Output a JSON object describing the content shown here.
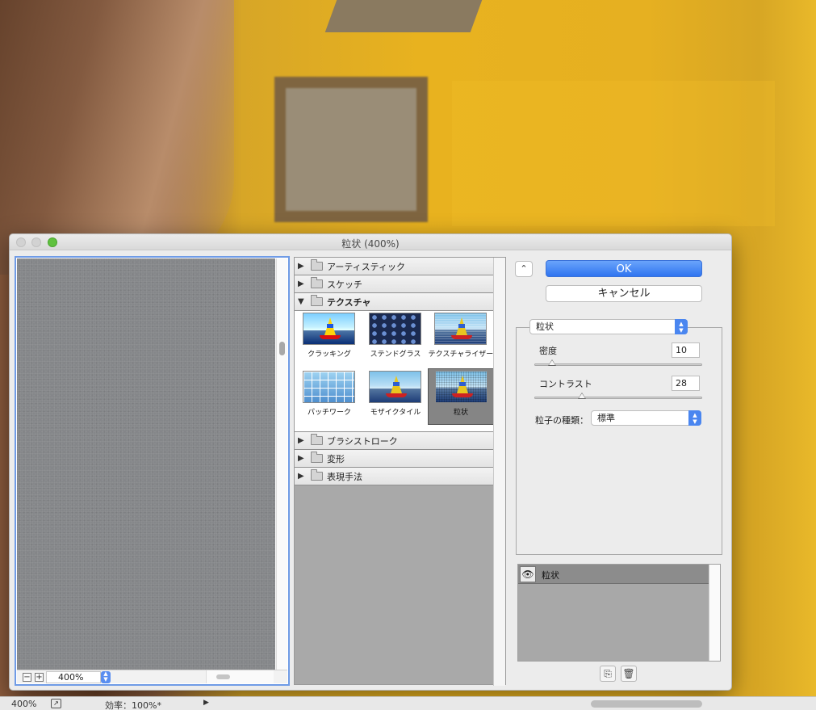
{
  "dialog": {
    "title": "粒状 (400%)",
    "ok_label": "OK",
    "cancel_label": "キャンセル"
  },
  "preview": {
    "zoom_value": "400%",
    "zoom_out_icon": "minus-icon",
    "zoom_in_icon": "plus-icon"
  },
  "gallery": {
    "categories": [
      {
        "label": "アーティスティック",
        "expanded": false
      },
      {
        "label": "スケッチ",
        "expanded": false
      },
      {
        "label": "テクスチャ",
        "expanded": true
      },
      {
        "label": "ブラシストローク",
        "expanded": false
      },
      {
        "label": "変形",
        "expanded": false
      },
      {
        "label": "表現手法",
        "expanded": false
      }
    ],
    "texture_filters": [
      {
        "label": "クラッキング",
        "selected": false
      },
      {
        "label": "ステンドグラス",
        "selected": false
      },
      {
        "label": "テクスチャライザー",
        "selected": false
      },
      {
        "label": "パッチワーク",
        "selected": false
      },
      {
        "label": "モザイクタイル",
        "selected": false
      },
      {
        "label": "粒状",
        "selected": true
      }
    ]
  },
  "settings": {
    "filter_selected": "粒状",
    "density_label": "密度",
    "density_value": "10",
    "density_level": 0.1,
    "contrast_label": "コントラスト",
    "contrast_value": "28",
    "contrast_level": 0.28,
    "grain_type_label": "粒子の種類：",
    "grain_type_value": "標準"
  },
  "layers": {
    "items": [
      {
        "label": "粒状",
        "visible": true
      }
    ]
  },
  "statusbar": {
    "zoom": "400%",
    "efficiency": "効率：100%*"
  },
  "colors": {
    "accent": "#2f74f0",
    "preview_gray": "#85878a",
    "background_yellow": "#e6b021"
  }
}
